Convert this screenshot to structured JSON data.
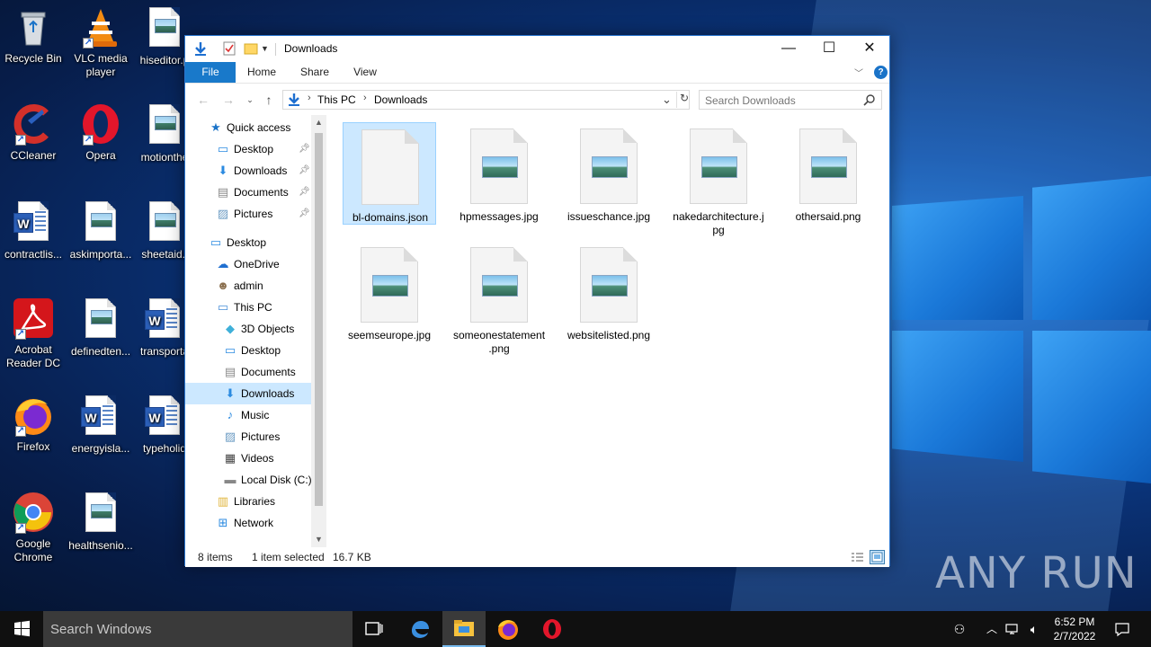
{
  "desktop": {
    "icons": [
      {
        "label": "Recycle Bin",
        "icon": "recycle-bin-icon"
      },
      {
        "label": "VLC media player",
        "icon": "vlc-icon"
      },
      {
        "label": "hiseditor.p",
        "icon": "image-file-icon"
      },
      {
        "label": "CCleaner",
        "icon": "ccleaner-icon"
      },
      {
        "label": "Opera",
        "icon": "opera-icon"
      },
      {
        "label": "motionthe",
        "icon": "image-file-icon"
      },
      {
        "label": "contractlis...",
        "icon": "word-doc-icon"
      },
      {
        "label": "askimporta...",
        "icon": "image-file-icon"
      },
      {
        "label": "sheetaid.j",
        "icon": "image-file-icon"
      },
      {
        "label": "Acrobat Reader DC",
        "icon": "acrobat-icon"
      },
      {
        "label": "definedten...",
        "icon": "image-file-icon"
      },
      {
        "label": "transporta",
        "icon": "word-doc-icon"
      },
      {
        "label": "Firefox",
        "icon": "firefox-icon"
      },
      {
        "label": "energyisla...",
        "icon": "word-doc-icon"
      },
      {
        "label": "typeholid",
        "icon": "word-doc-icon"
      },
      {
        "label": "Google Chrome",
        "icon": "chrome-icon"
      },
      {
        "label": "healthsenio...",
        "icon": "image-file-icon"
      }
    ],
    "watermark": "ANY RUN"
  },
  "explorer": {
    "title": "Downloads",
    "window_controls": {
      "minimize": "—",
      "maximize": "☐",
      "close": "✕"
    },
    "ribbon_tabs": [
      "File",
      "Home",
      "Share",
      "View"
    ],
    "address": {
      "crumbs": [
        "This PC",
        "Downloads"
      ]
    },
    "search": {
      "placeholder": "Search Downloads"
    },
    "nav": [
      {
        "label": "Quick access",
        "icon": "star-icon",
        "indent": 0,
        "pinned": false
      },
      {
        "label": "Desktop",
        "icon": "desktop-folder-icon",
        "indent": 1,
        "pinned": true
      },
      {
        "label": "Downloads",
        "icon": "download-folder-icon",
        "indent": 1,
        "pinned": true
      },
      {
        "label": "Documents",
        "icon": "documents-folder-icon",
        "indent": 1,
        "pinned": true
      },
      {
        "label": "Pictures",
        "icon": "pictures-folder-icon",
        "indent": 1,
        "pinned": true
      },
      {
        "label": "Desktop",
        "icon": "desktop-folder-icon",
        "indent": 0,
        "pinned": false
      },
      {
        "label": "OneDrive",
        "icon": "onedrive-icon",
        "indent": 1,
        "pinned": false
      },
      {
        "label": "admin",
        "icon": "user-icon",
        "indent": 1,
        "pinned": false
      },
      {
        "label": "This PC",
        "icon": "computer-icon",
        "indent": 1,
        "pinned": false
      },
      {
        "label": "3D Objects",
        "icon": "3d-objects-icon",
        "indent": 2,
        "pinned": false
      },
      {
        "label": "Desktop",
        "icon": "desktop-folder-icon",
        "indent": 2,
        "pinned": false
      },
      {
        "label": "Documents",
        "icon": "documents-folder-icon",
        "indent": 2,
        "pinned": false
      },
      {
        "label": "Downloads",
        "icon": "download-folder-icon",
        "indent": 2,
        "pinned": false,
        "selected": true
      },
      {
        "label": "Music",
        "icon": "music-icon",
        "indent": 2,
        "pinned": false
      },
      {
        "label": "Pictures",
        "icon": "pictures-folder-icon",
        "indent": 2,
        "pinned": false
      },
      {
        "label": "Videos",
        "icon": "videos-icon",
        "indent": 2,
        "pinned": false
      },
      {
        "label": "Local Disk (C:)",
        "icon": "drive-icon",
        "indent": 2,
        "pinned": false
      },
      {
        "label": "Libraries",
        "icon": "libraries-icon",
        "indent": 1,
        "pinned": false
      },
      {
        "label": "Network",
        "icon": "network-icon",
        "indent": 1,
        "pinned": false
      }
    ],
    "files": [
      {
        "name": "bl-domains.json",
        "kind": "blank",
        "selected": true
      },
      {
        "name": "hpmessages.jpg",
        "kind": "image"
      },
      {
        "name": "issueschance.jpg",
        "kind": "image"
      },
      {
        "name": "nakedarchitecture.jpg",
        "kind": "image"
      },
      {
        "name": "othersaid.png",
        "kind": "image"
      },
      {
        "name": "seemseurope.jpg",
        "kind": "image"
      },
      {
        "name": "someonestatement.png",
        "kind": "image"
      },
      {
        "name": "websitelisted.png",
        "kind": "image"
      }
    ],
    "status": {
      "item_count": "8 items",
      "selection": "1 item selected",
      "size": "16.7 KB"
    }
  },
  "taskbar": {
    "search_placeholder": "Search Windows",
    "apps": [
      "task-view-icon",
      "edge-icon",
      "file-explorer-icon",
      "firefox-icon",
      "opera-icon"
    ],
    "clock_time": "6:52 PM",
    "clock_date": "2/7/2022"
  },
  "colors": {
    "accent": "#1979ca",
    "selection": "#cce8ff",
    "taskbar": "#101010"
  }
}
